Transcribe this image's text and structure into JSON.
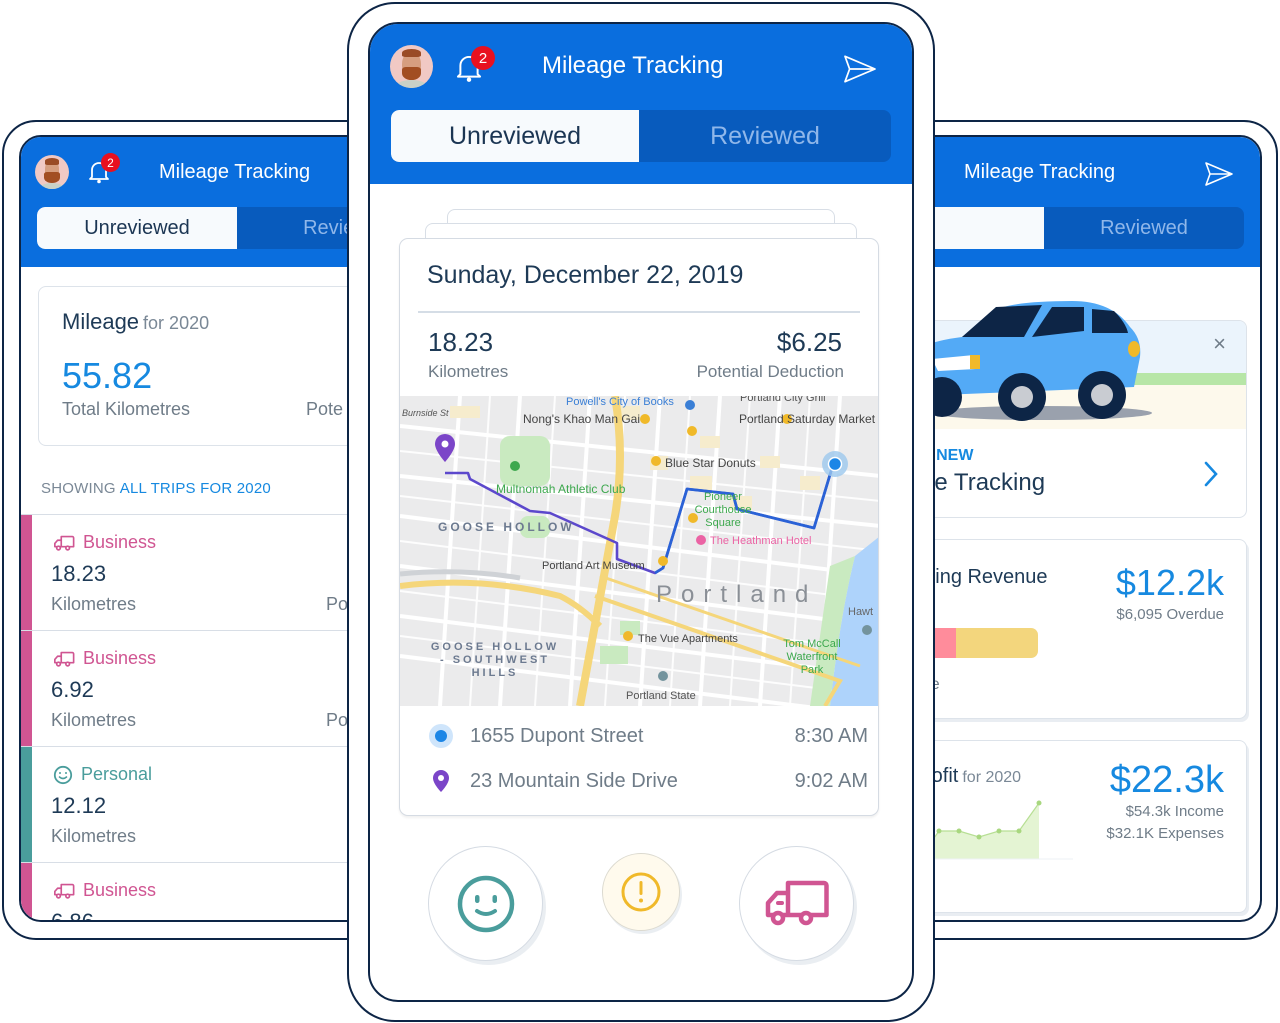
{
  "app": {
    "title": "Mileage Tracking",
    "notification_count": "2",
    "tabs": [
      {
        "label": "Unreviewed",
        "active": true
      },
      {
        "label": "Reviewed",
        "active": false
      }
    ]
  },
  "colors": {
    "header_blue": "#0a6ede",
    "accent_blue": "#1689e0",
    "business_pink": "#d05592",
    "personal_teal": "#4a9d9c",
    "flag_yellow": "#f0b92a",
    "start_pin_blue": "#1c86e6",
    "end_pin_purple": "#7b45c8",
    "route_blue": "#2a62d6",
    "route_purple": "#6247c9",
    "badge_red": "#e8101f"
  },
  "left_phone": {
    "mileage_card": {
      "title": "Mileage",
      "title_suffix": "for 2020",
      "total_value": "55.82",
      "total_label": "Total Kilometres",
      "secondary_label_partial": "Pote"
    },
    "filter": {
      "prefix": "SHOWING",
      "value": "ALL TRIPS FOR 2020"
    },
    "trips": [
      {
        "category": "Business",
        "icon": "truck-icon",
        "distance": "18.23",
        "unit": "Kilometres",
        "deduction_partial": "Po"
      },
      {
        "category": "Business",
        "icon": "truck-icon",
        "distance": "6.92",
        "unit": "Kilometres",
        "deduction_partial": "Po"
      },
      {
        "category": "Personal",
        "icon": "smiley-icon",
        "distance": "12.12",
        "unit": "Kilometres",
        "deduction_partial": ""
      },
      {
        "category": "Business",
        "icon": "truck-icon",
        "distance": "6.86",
        "unit": "",
        "deduction_partial": ""
      }
    ]
  },
  "center_phone": {
    "trip": {
      "date": "Sunday, December 22, 2019",
      "distance": "18.23",
      "distance_label": "Kilometres",
      "deduction": "$6.25",
      "deduction_label": "Potential Deduction",
      "map_labels": [
        "Powell's City of Books",
        "Portland City Grill",
        "Nong's Khao Man Gai",
        "Portland Saturday Market",
        "Burnside St",
        "Blue Star Donuts",
        "Multnomah Athletic Club",
        "Pioneer Courthouse Square",
        "GOOSE HOLLOW",
        "The Heathman Hotel",
        "Portland Art Museum",
        "Portland",
        "Hawt",
        "The Vue Apartments",
        "GOOSE HOLLOW - SOUTHWEST HILLS",
        "Tom McCall Waterfront Park",
        "Portland State"
      ],
      "stops": [
        {
          "type": "start",
          "address": "1655 Dupont Street",
          "time": "8:30 AM"
        },
        {
          "type": "end",
          "address": "23 Mountain Side Drive",
          "time": "9:02 AM"
        }
      ]
    },
    "actions": [
      {
        "name": "personal",
        "icon": "smiley-icon"
      },
      {
        "name": "flag",
        "icon": "exclamation-circle-icon"
      },
      {
        "name": "business",
        "icon": "truck-icon"
      }
    ]
  },
  "right_phone": {
    "promo": {
      "kicker_partial": "E NEW",
      "headline_partial": "ge Tracking",
      "close_label": "×"
    },
    "revenue_card": {
      "title_partial": "nding Revenue",
      "amount": "$12.2k",
      "overdue": "$6,095 Overdue",
      "footer_partial": "due",
      "overdue_fraction": 0.5
    },
    "profit_card": {
      "title_partial": "rofit",
      "title_suffix": "for 2020",
      "amount": "$22.3k",
      "income": "$54.3k Income",
      "expenses": "$32.1K Expenses"
    }
  }
}
